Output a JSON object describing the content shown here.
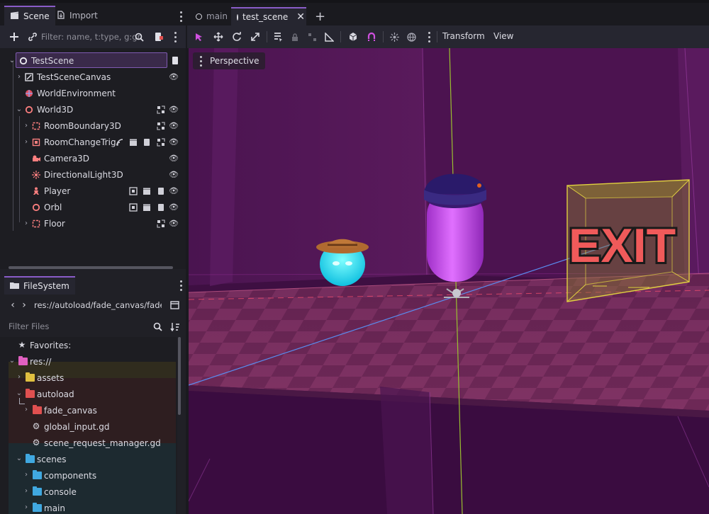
{
  "colors": {
    "accent": "#8a5cc8",
    "node_3d": "#fc7f7f",
    "node_2d": "#8da5f3",
    "folder_yellow": "#e0c040",
    "folder_red": "#e05050",
    "folder_blue": "#40a8e0",
    "folder_pink": "#e060c0",
    "exit_text": "#f05050"
  },
  "scene_dock": {
    "tabs": [
      {
        "label": "Scene",
        "icon": "scene-icon"
      },
      {
        "label": "Import",
        "icon": "import-icon"
      }
    ],
    "filter_placeholder": "Filter: name, t:type, g:gr",
    "nodes": [
      {
        "label": "TestScene",
        "icon": "node3d-circle-icon",
        "selected": true,
        "badges": []
      },
      {
        "label": "TestSceneCanvas",
        "icon": "canvas-layer-icon",
        "badges": [
          "visibility-icon"
        ]
      },
      {
        "label": "WorldEnvironment",
        "icon": "world-environment-icon",
        "badges": []
      },
      {
        "label": "World3D",
        "icon": "node3d-circle-icon",
        "badges": [
          "group-icon",
          "visibility-icon"
        ]
      },
      {
        "label": "RoomBoundary3D",
        "icon": "area3d-icon",
        "badges": [
          "group-icon",
          "visibility-icon"
        ]
      },
      {
        "label": "RoomChangeTrig",
        "icon": "area3d-icon",
        "badges": [
          "signal-icon",
          "clapper-icon",
          "script-icon",
          "group-icon",
          "visibility-icon"
        ]
      },
      {
        "label": "Camera3D",
        "icon": "camera-icon",
        "badges": [
          "visibility-icon"
        ]
      },
      {
        "label": "DirectionalLight3D",
        "icon": "light-icon",
        "badges": [
          "visibility-icon"
        ]
      },
      {
        "label": "Player",
        "icon": "character-icon",
        "badges": [
          "instance-icon",
          "clapper-icon",
          "script-icon",
          "visibility-icon"
        ]
      },
      {
        "label": "Orbl",
        "icon": "node3d-circle-icon",
        "badges": [
          "instance-icon",
          "clapper-icon",
          "script-icon",
          "visibility-icon"
        ]
      },
      {
        "label": "Floor",
        "icon": "area3d-icon",
        "badges": [
          "group-icon",
          "visibility-icon"
        ]
      }
    ]
  },
  "filesystem": {
    "tab_label": "FileSystem",
    "path": "res://autoload/fade_canvas/fade_c",
    "filter_placeholder": "Filter Files",
    "items": [
      {
        "label": "Favorites:",
        "kind": "star"
      },
      {
        "label": "res://",
        "kind": "folder-pink"
      },
      {
        "label": "assets",
        "kind": "folder-yellow"
      },
      {
        "label": "autoload",
        "kind": "folder-red"
      },
      {
        "label": "fade_canvas",
        "kind": "folder-red"
      },
      {
        "label": "global_input.gd",
        "kind": "gear"
      },
      {
        "label": "scene_request_manager.gd",
        "kind": "gear"
      },
      {
        "label": "scenes",
        "kind": "folder-blue"
      },
      {
        "label": "components",
        "kind": "folder-blue"
      },
      {
        "label": "console",
        "kind": "folder-blue"
      },
      {
        "label": "main",
        "kind": "folder-blue"
      }
    ]
  },
  "editor": {
    "doc_tabs": [
      "main",
      "test_scene"
    ],
    "active_tab": "test_scene",
    "menus": [
      "Transform",
      "View"
    ],
    "perspective_label": "Perspective",
    "exit_sign": "EXIT"
  }
}
